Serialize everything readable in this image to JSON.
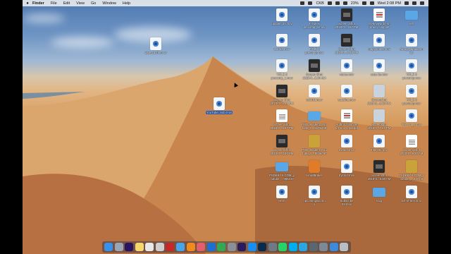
{
  "menubar": {
    "app": "Finder",
    "items": [
      "File",
      "Edit",
      "View",
      "Go",
      "Window",
      "Help"
    ],
    "input_source": "CKB",
    "battery": "23%",
    "clock": "Wed 2:08 PM"
  },
  "desktop_left": [
    {
      "label": "wipe-cache.mov",
      "kind": "mov"
    },
    {
      "label": "YouTube_Sub.mov",
      "kind": "mov"
    }
  ],
  "desktop_grid": [
    {
      "label": "update_us.mov",
      "kind": "mov"
    },
    {
      "label": "TITLE 5\nprecomp_1.mov",
      "kind": "mov"
    },
    {
      "label": "Screen Shot\n2018-0...4.57 PM",
      "kind": "shot"
    },
    {
      "label": "ssi-keywords-to-\ngrow-y...ing.pdf",
      "kind": "pdf"
    },
    {
      "label": "afs",
      "kind": "folder"
    },
    {
      "label": "warota.mov",
      "kind": "mov"
    },
    {
      "label": "TITLE 6\nprecomp.mov",
      "kind": "mov"
    },
    {
      "label": "Screen Shot\n2018-0...6.06 PM",
      "kind": "shot"
    },
    {
      "label": "majorpoints.mov",
      "kind": "mov"
    },
    {
      "label": "always_update.m\nov",
      "kind": "mov"
    },
    {
      "label": "TITLE 6\nprecomp_1.mov",
      "kind": "mov"
    },
    {
      "label": "Screen Shot\n2018-0...5.34 AM",
      "kind": "shot"
    },
    {
      "label": "name.mov",
      "kind": "mov"
    },
    {
      "label": "ssus-ite.mov",
      "kind": "mov"
    },
    {
      "label": "TITLE 6\nprecomp.mov",
      "kind": "mov"
    },
    {
      "label": "Screen Shot\n2018-0...5.53 PM",
      "kind": "shot"
    },
    {
      "label": "sslorist.mov",
      "kind": "mov"
    },
    {
      "label": "ssusilne.mov",
      "kind": "mov"
    },
    {
      "label": "Screenshot\n2018-0...6.50 PM",
      "kind": "img"
    },
    {
      "label": "TITLE 8\nprecomp.mov",
      "kind": "mov"
    },
    {
      "label": "Screen Shot\n2018-0...6.57 PM",
      "kind": "doc"
    },
    {
      "label": "PSD_Modern_You\ntube_C...5175438",
      "kind": "folder"
    },
    {
      "label": "AuthorizationLet\nter-Soc...mat.pdf",
      "kind": "pdf"
    },
    {
      "label": "Screenshot\n2018-0...7.26 PM",
      "kind": "img"
    },
    {
      "label": "Title 14_1.mov",
      "kind": "mov"
    },
    {
      "label": "Screen Shot\n2018-0...0.20 PM",
      "kind": "shot"
    },
    {
      "label": "PSD_Modern_You\ntube_C...5036.rar",
      "kind": "rar"
    },
    {
      "label": "extract.mov",
      "kind": "mov"
    },
    {
      "label": "Title 20.mov",
      "kind": "mov"
    },
    {
      "label": "Screen Shot\n2018-0...5.30 AM",
      "kind": "doc"
    },
    {
      "label": "PSDKEYS.COM_y\noutube_...965317",
      "kind": "folder"
    },
    {
      "label": "HandBrake",
      "kind": "brake"
    },
    {
      "label": "trycmd.mov",
      "kind": "mov"
    },
    {
      "label": "Screenshot\n2018-0...6.38 AM",
      "kind": "shot"
    },
    {
      "label": "PSDKEYS.COM_y\noutube_...317.rar",
      "kind": "rar"
    },
    {
      "label": "Here",
      "kind": "mov"
    },
    {
      "label": "upcomingvid.mo\nv",
      "kind": "mov"
    },
    {
      "label": "Subscribe\n03.mov",
      "kind": "mov"
    },
    {
      "label": "sccg",
      "kind": "folder"
    },
    {
      "label": "list-of-dev.mov",
      "kind": "mov"
    }
  ],
  "dock": [
    {
      "icon": "finder-icon",
      "color": "#3b8fe6"
    },
    {
      "icon": "launchpad-icon",
      "color": "#9aa4b2"
    },
    {
      "icon": "premiere-icon",
      "color": "#2a1460"
    },
    {
      "icon": "notes-icon",
      "color": "#f5d76e"
    },
    {
      "icon": "textedit-icon",
      "color": "#e8e8e8"
    },
    {
      "icon": "app-icon",
      "color": "#cfcfcf"
    },
    {
      "icon": "filezilla-icon",
      "color": "#c62828"
    },
    {
      "icon": "safari-icon",
      "color": "#4aa3e8"
    },
    {
      "icon": "vlc-icon",
      "color": "#f08a1c"
    },
    {
      "icon": "photos-icon",
      "color": "#e35d6a"
    },
    {
      "icon": "teamviewer-icon",
      "color": "#1f6fd1"
    },
    {
      "icon": "chrome-icon",
      "color": "#34a853"
    },
    {
      "icon": "settings-icon",
      "color": "#8a8f98"
    },
    {
      "icon": "after-effects-icon",
      "color": "#2c1a5e"
    },
    {
      "icon": "app-store-icon",
      "color": "#1b8cf0"
    },
    {
      "icon": "photoshop-icon",
      "color": "#0b2a4a"
    },
    {
      "icon": "finder-window-icon",
      "color": "#6f7a86"
    },
    {
      "icon": "whatsapp-icon",
      "color": "#25d366"
    },
    {
      "icon": "skype-icon",
      "color": "#00aff0"
    },
    {
      "icon": "telegram-icon",
      "color": "#2ca5e0"
    },
    {
      "icon": "quicktime-icon",
      "color": "#5c6670"
    },
    {
      "icon": "preview-icon",
      "color": "#7b8a96"
    },
    {
      "icon": "folder-icon",
      "color": "#3e89d8"
    },
    {
      "icon": "trash-icon",
      "color": "#b9bec6"
    }
  ]
}
